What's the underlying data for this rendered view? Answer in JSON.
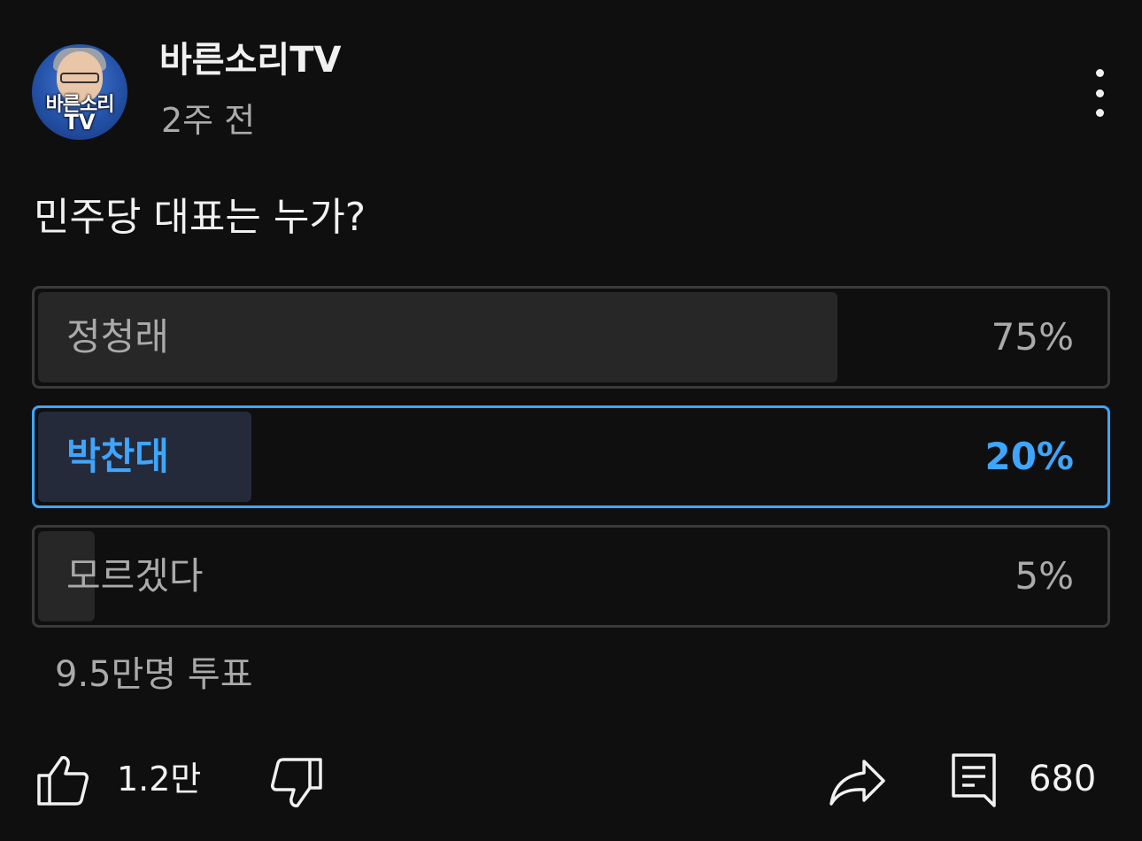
{
  "channel": {
    "name": "바른소리TV",
    "posted": "2주 전",
    "avatar_text_line1": "바른소리",
    "avatar_text_line2": "TV"
  },
  "menu": {
    "icon": "more-vertical-icon"
  },
  "poll": {
    "question": "민주당 대표는 누가?",
    "options": [
      {
        "label": "정청래",
        "percent_text": "75%",
        "percent": 75,
        "selected": false
      },
      {
        "label": "박찬대",
        "percent_text": "20%",
        "percent": 20,
        "selected": true
      },
      {
        "label": "모르겠다",
        "percent_text": "5%",
        "percent": 5,
        "selected": false
      }
    ],
    "votes": "9.5만명 투표"
  },
  "actions": {
    "like_icon": "thumbs-up-icon",
    "like_count": "1.2만",
    "dislike_icon": "thumbs-down-icon",
    "share_icon": "share-icon",
    "comment_icon": "comment-icon",
    "comment_count": "680"
  },
  "colors": {
    "background": "#0f0f0f",
    "accent": "#3ea6ff",
    "muted_text": "#aaaaaa"
  }
}
